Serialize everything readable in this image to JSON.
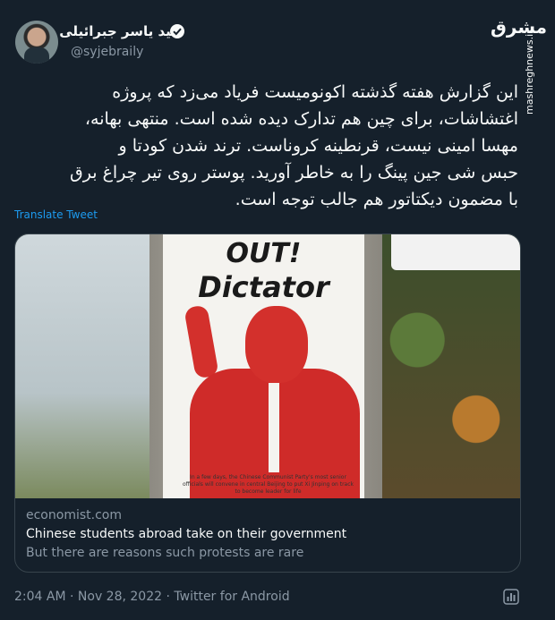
{
  "author": {
    "display_name": "سید یاسر جبرائیلی",
    "handle": "@syjebraily"
  },
  "watermark": {
    "logo": "مشرق",
    "url": "mashreghnews.ir"
  },
  "tweet": {
    "text_lines": [
      "این گزارش هفته گذشته اکونومیست فریاد می‌زد که پروژه",
      "اغتشاشات، برای چین هم تدارک دیده شده است. منتهی بهانه،",
      "مهسا امینی نیست، قرنطینه کروناست. ترند شدن کودتا و",
      "حبس شی جین پینگ را به خاطر آورید. پوستر روی تیر چراغ برق",
      "با مضمون دیکتاتور هم جالب توجه است."
    ],
    "translate_label": "Translate Tweet"
  },
  "card": {
    "poster_line1": "OUT!",
    "poster_line2": "Dictator",
    "poster_fine_print": "In a few days, the Chinese Communist Party's most senior officials will convene in central Beijing to put Xi Jinping on track to become leader for life",
    "domain": "economist.com",
    "title": "Chinese students abroad take on their government",
    "description": "But there are reasons such protests are rare"
  },
  "meta": {
    "time": "2:04 AM",
    "separator": "·",
    "date": "Nov 28, 2022",
    "source": "Twitter for Android"
  },
  "icons": {
    "verified": "verified-badge-icon",
    "analytics": "analytics-icon"
  },
  "colors": {
    "background": "#15202b",
    "link": "#1d9bf0",
    "muted": "#8b98a5",
    "border": "#38444d"
  }
}
